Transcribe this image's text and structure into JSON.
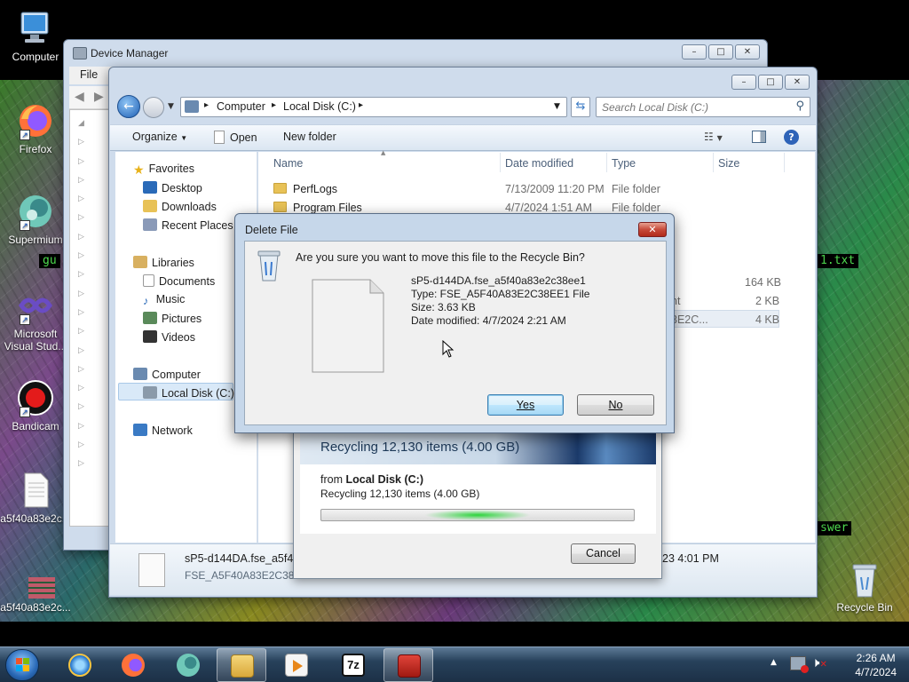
{
  "desktop": {
    "icons": [
      {
        "label": "Computer"
      },
      {
        "label": "Firefox"
      },
      {
        "label": "Supermium"
      },
      {
        "label": "Microsoft Visual Stud..."
      },
      {
        "label": "Bandicam"
      },
      {
        "label": "a5f40a83e2c..."
      },
      {
        "label": "a5f40a83e2c..."
      },
      {
        "label": "Recycle Bin"
      }
    ],
    "terminal_fragments": [
      "gu",
      "1.txt",
      "swer"
    ]
  },
  "device_manager": {
    "title": "Device Manager",
    "menu_file": "File"
  },
  "explorer": {
    "breadcrumb": [
      "Computer",
      "Local Disk (C:)"
    ],
    "search_placeholder": "Search Local Disk (C:)",
    "toolbar": {
      "organize": "Organize",
      "open": "Open",
      "new_folder": "New folder"
    },
    "nav": {
      "favorites": "Favorites",
      "desktop": "Desktop",
      "downloads": "Downloads",
      "recent": "Recent Places",
      "libraries": "Libraries",
      "documents": "Documents",
      "music": "Music",
      "pictures": "Pictures",
      "videos": "Videos",
      "computer": "Computer",
      "local_disk": "Local Disk (C:)",
      "network": "Network"
    },
    "columns": {
      "name": "Name",
      "date": "Date modified",
      "type": "Type",
      "size": "Size"
    },
    "files": [
      {
        "name": "PerfLogs",
        "date": "7/13/2009 11:20 PM",
        "type": "File folder",
        "size": ""
      },
      {
        "name": "Program Files",
        "date": "4/7/2024 1:51 AM",
        "type": "File folder",
        "size": ""
      }
    ],
    "partial_rows": [
      {
        "type": "",
        "size": "164 KB"
      },
      {
        "type": "nt",
        "size": "2 KB"
      },
      {
        "type": "3E2C...",
        "size": "4 KB"
      }
    ],
    "details": {
      "name": "sP5-d144DA.fse_a5f40",
      "type": "FSE_A5F40A83E2C38EE1",
      "date": "23 4:01 PM"
    }
  },
  "recycling": {
    "header": "Recycling 12,130 items (4.00 GB)",
    "from_label": "from",
    "from_value": "Local Disk (C:)",
    "status": "Recycling 12,130 items (4.00 GB)",
    "cancel": "Cancel",
    "progress": 0.5
  },
  "delete_dialog": {
    "title": "Delete File",
    "question": "Are you sure you want to move this file to the Recycle Bin?",
    "file_name": "sP5-d144DA.fse_a5f40a83e2c38ee1",
    "file_type": "Type: FSE_A5F40A83E2C38EE1 File",
    "file_size": "Size: 3.63 KB",
    "file_date": "Date modified: 4/7/2024 2:21 AM",
    "yes": "Yes",
    "no": "No"
  },
  "taskbar": {
    "time": "2:26 AM",
    "date": "4/7/2024"
  }
}
